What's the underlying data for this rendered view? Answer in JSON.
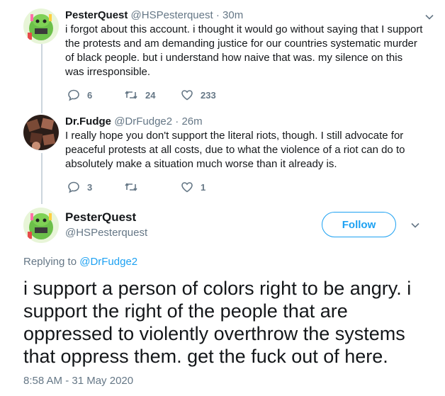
{
  "tweets": [
    {
      "name": "PesterQuest",
      "handle": "@HSPesterquest",
      "time": "· 30m",
      "text": "i forgot about this account. i thought it would go without saying that I support the protests and am demanding justice for our countries systematic murder of black people. but i understand how naive that was. my silence on this was irresponsible.",
      "replies": "6",
      "retweets": "24",
      "likes": "233"
    },
    {
      "name": "Dr.Fudge",
      "handle": "@DrFudge2",
      "time": "· 26m",
      "text": "I really hope you don't support the literal riots, though. I still advocate for peaceful protests at all costs, due to what the violence of a riot can do to absolutely make a situation much worse than it already is.",
      "replies": "3",
      "retweets": "",
      "likes": "1"
    }
  ],
  "main_tweet": {
    "name": "PesterQuest",
    "handle": "@HSPesterquest",
    "follow_label": "Follow",
    "replying_prefix": "Replying to",
    "replying_to": "@DrFudge2",
    "text": "i support a person of colors right to be angry. i support the right of the people that are oppressed to violently overthrow the systems that oppress them. get the fuck out of here.",
    "timestamp": "8:58 AM - 31 May 2020"
  },
  "colors": {
    "accent": "#1da1f2",
    "muted": "#657786",
    "thread_line": "#ccd6dd"
  },
  "icons": [
    "reply-icon",
    "retweet-icon",
    "like-icon",
    "chevron-down-icon",
    "avatar"
  ]
}
